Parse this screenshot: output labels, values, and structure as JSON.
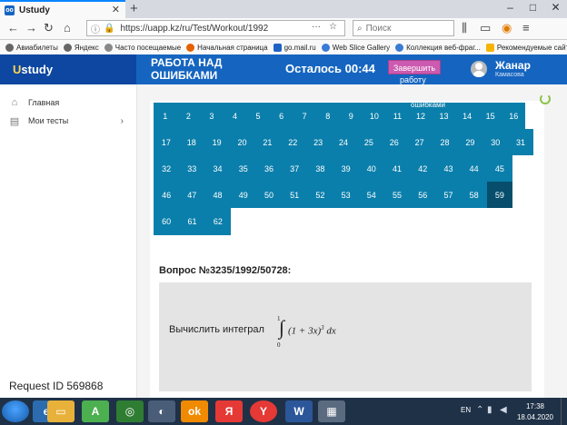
{
  "browser": {
    "tab_title": "Ustudy",
    "tab_favicon": "oo",
    "new_tab": "+",
    "url": "https://uapp.kz/ru/Test/Workout/1992",
    "url_menu": "···",
    "search_placeholder": "Поиск",
    "window_controls": [
      "–",
      "□",
      "✕"
    ],
    "bookmarks": [
      "Авиабилеты",
      "Яндекс",
      "Часто посещаемые",
      "Начальная страница",
      "go.mail.ru",
      "Web Slice Gallery",
      "Коллекция веб-фраг...",
      "Рекомендуемые сайты"
    ]
  },
  "header": {
    "logo_u": "U",
    "logo_rest": "study",
    "work_title": "РАБОТА НАД ОШИБКАМИ",
    "timer": "Осталось 00:44",
    "finish_label": "Завершить",
    "finish_label_2": "работу",
    "user_name": "Жанар",
    "user_sub": "Камасова"
  },
  "sidebar": {
    "items": [
      {
        "label": "Главная",
        "icon": "home-icon"
      },
      {
        "label": "Мои тесты",
        "icon": "document-icon",
        "arrow": "›"
      }
    ],
    "request_id": "Request ID 569868"
  },
  "questions": {
    "label": "ошибками",
    "active": 59,
    "rows": [
      [
        1,
        2,
        3,
        4,
        5,
        6,
        7,
        8,
        9,
        10,
        11,
        12,
        13,
        14,
        15,
        16
      ],
      [
        17,
        18,
        19,
        20,
        21,
        22,
        23,
        24,
        25,
        26,
        27,
        28,
        29,
        30,
        31
      ],
      [
        32,
        33,
        34,
        35,
        36,
        37,
        38,
        39,
        40,
        41,
        42,
        43,
        44,
        45
      ],
      [
        46,
        47,
        48,
        49,
        50,
        51,
        52,
        53,
        54,
        55,
        56,
        57,
        58,
        59
      ],
      [
        60,
        61,
        62
      ]
    ]
  },
  "question": {
    "title": "Вопрос №3235/1992/50728:",
    "text": "Вычислить интеграл",
    "integral_upper": "1",
    "integral_lower": "0",
    "integral_base": "(1 + 3x)",
    "integral_exp": "3",
    "integral_dx": " dx"
  },
  "taskbar": {
    "lang": "EN",
    "time": "17:38",
    "date": "18.04.2020"
  }
}
